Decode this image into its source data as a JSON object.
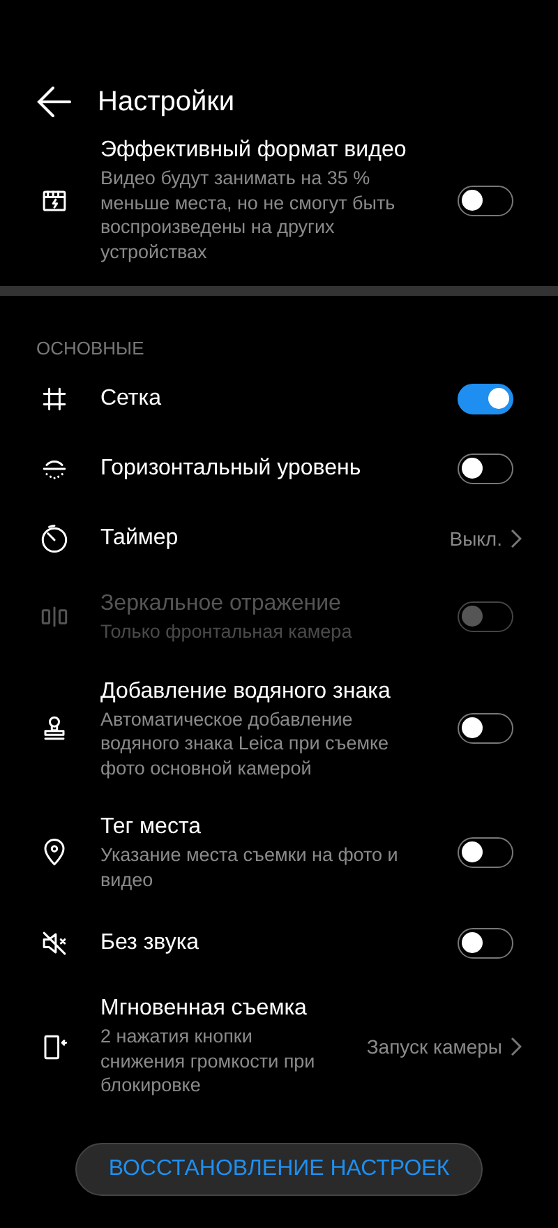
{
  "header": {
    "title": "Настройки"
  },
  "top_items": [
    {
      "title": "Эффективный формат видео",
      "subtitle": "Видео будут занимать на 35 % меньше места, но не смогут быть воспроизведены на других устройствах",
      "kind": "toggle",
      "on": false,
      "disabled": false
    }
  ],
  "section": {
    "title": "ОСНОВНЫЕ"
  },
  "items": [
    {
      "title": "Сетка",
      "kind": "toggle",
      "on": true,
      "disabled": false
    },
    {
      "title": "Горизонтальный уровень",
      "kind": "toggle",
      "on": false,
      "disabled": false
    },
    {
      "title": "Таймер",
      "kind": "value",
      "value": "Выкл.",
      "disabled": false
    },
    {
      "title": "Зеркальное отражение",
      "subtitle": "Только фронтальная камера",
      "kind": "toggle",
      "on": false,
      "disabled": true
    },
    {
      "title": "Добавление водяного знака",
      "subtitle": "Автоматическое добавление водяного знака Leica при съемке фото основной камерой",
      "kind": "toggle",
      "on": false,
      "disabled": false
    },
    {
      "title": "Тег места",
      "subtitle": "Указание места съемки на фото и видео",
      "kind": "toggle",
      "on": false,
      "disabled": false
    },
    {
      "title": "Без звука",
      "kind": "toggle",
      "on": false,
      "disabled": false
    },
    {
      "title": "Мгновенная съемка",
      "subtitle": "2 нажатия кнопки снижения громкости при блокировке",
      "kind": "value",
      "value": "Запуск камеры",
      "disabled": false
    }
  ],
  "reset_button": {
    "label": "ВОССТАНОВЛЕНИЕ НАСТРОЕК"
  }
}
